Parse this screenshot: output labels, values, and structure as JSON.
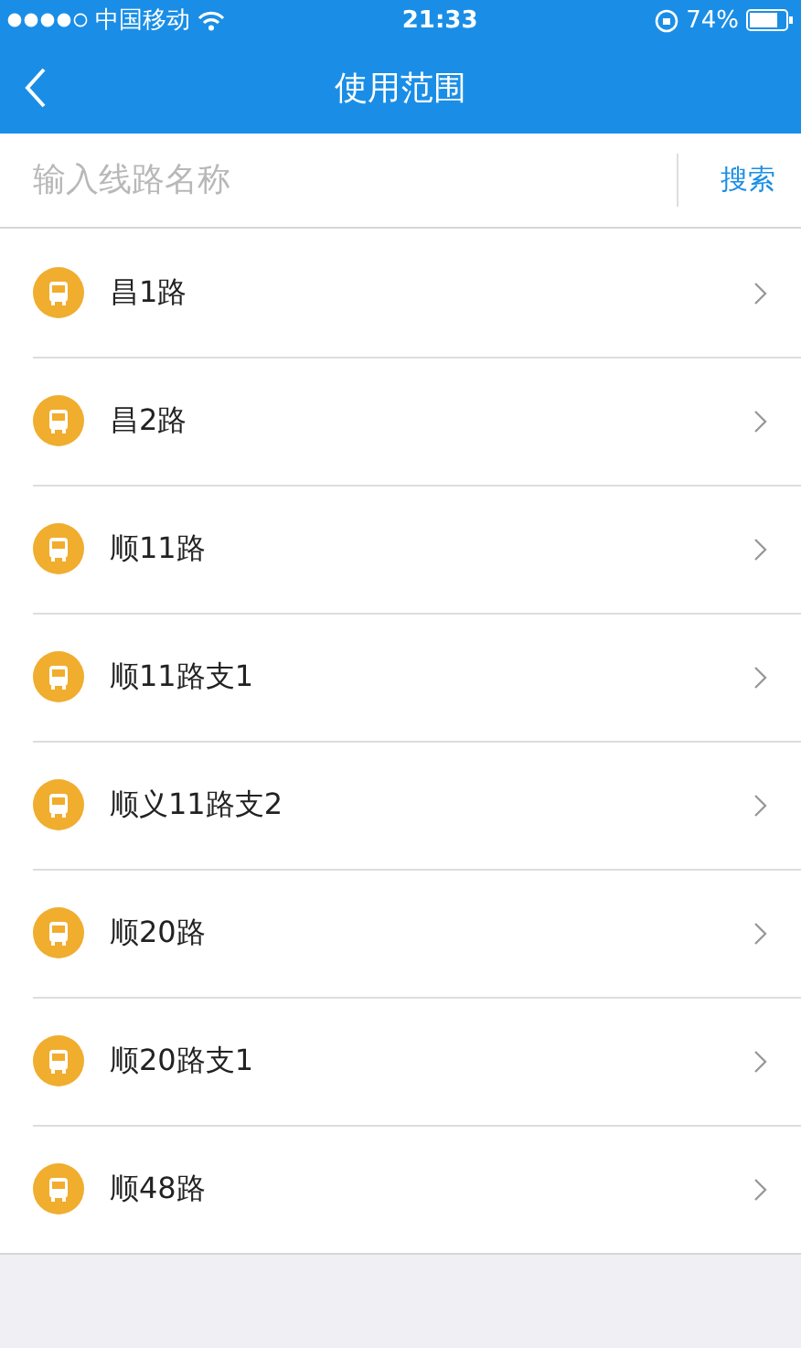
{
  "status_bar": {
    "carrier": "中国移动",
    "time": "21:33",
    "battery": "74%"
  },
  "nav_bar": {
    "title": "使用范围"
  },
  "search": {
    "placeholder": "输入线路名称",
    "button": "搜索"
  },
  "routes": [
    {
      "name": "昌1路"
    },
    {
      "name": "昌2路"
    },
    {
      "name": "顺11路"
    },
    {
      "name": "顺11路支1"
    },
    {
      "name": "顺义11路支2"
    },
    {
      "name": "顺20路"
    },
    {
      "name": "顺20路支1"
    },
    {
      "name": "顺48路"
    }
  ]
}
